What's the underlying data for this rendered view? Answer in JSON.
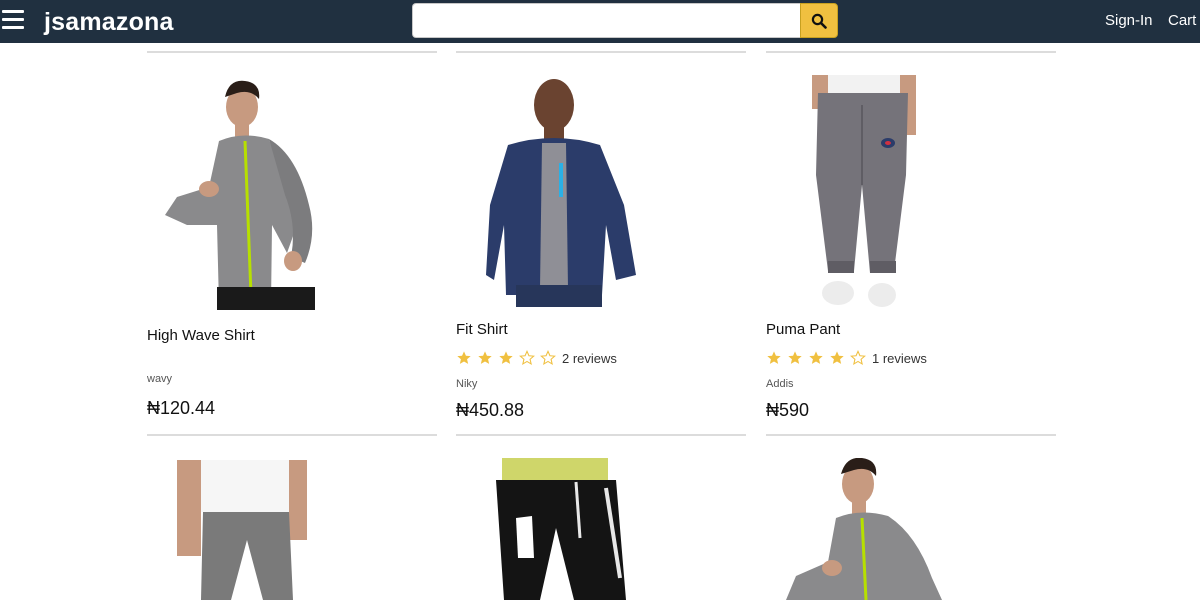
{
  "header": {
    "brand": "jsamazona",
    "search": {
      "value": "",
      "placeholder": ""
    },
    "menu_icon": "hamburger-menu-icon",
    "search_icon": "magnifier-icon",
    "nav": {
      "signin": "Sign-In",
      "cart": "Cart"
    }
  },
  "colors": {
    "header_bg": "#203040",
    "search_button": "#f0c040",
    "star": "#f0c040"
  },
  "products": [
    {
      "name": "High Wave Shirt",
      "brand": "wavy",
      "price": "₦120.44",
      "rating": null,
      "reviews": ""
    },
    {
      "name": "Fit Shirt",
      "brand": "Niky",
      "price": "₦450.88",
      "rating": 3,
      "reviews": "2 reviews"
    },
    {
      "name": "Puma Pant",
      "brand": "Addis",
      "price": "₦590",
      "rating": 4,
      "reviews": "1 reviews"
    },
    {
      "name": "",
      "brand": "",
      "price": "",
      "rating": null,
      "reviews": ""
    },
    {
      "name": "",
      "brand": "",
      "price": "",
      "rating": null,
      "reviews": ""
    },
    {
      "name": "",
      "brand": "",
      "price": "",
      "rating": null,
      "reviews": ""
    }
  ]
}
